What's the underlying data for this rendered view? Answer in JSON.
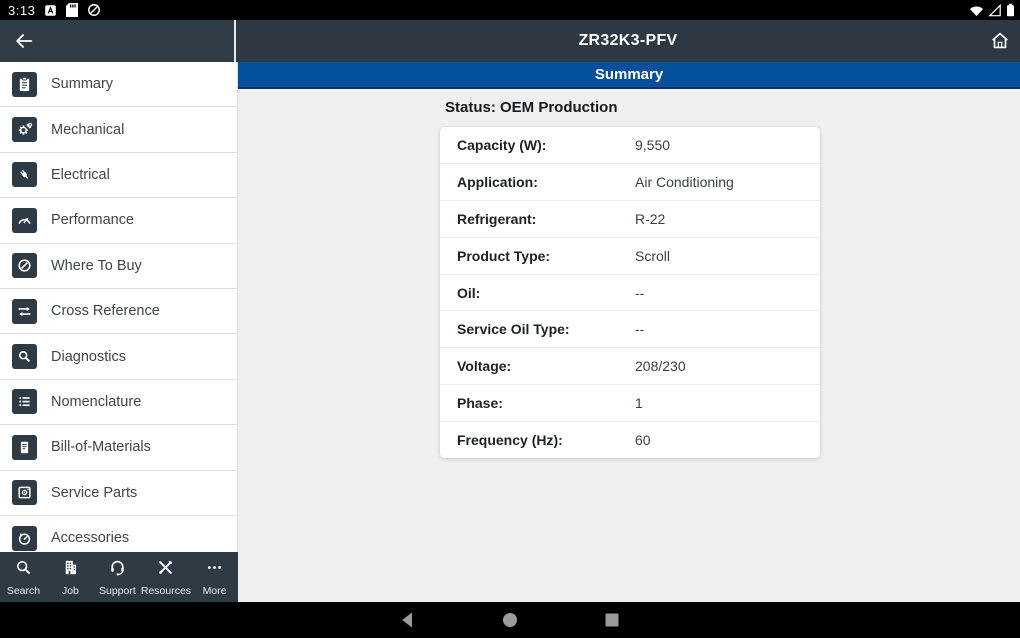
{
  "status_bar": {
    "time": "3:13",
    "left_icons": [
      "auto-rotate-a-icon",
      "sd-card-icon",
      "data-saver-icon"
    ],
    "right_icons": [
      "wifi-icon",
      "cell-signal-icon",
      "battery-icon"
    ]
  },
  "app_header": {
    "title": "ZR32K3-PFV",
    "back_icon": "back-arrow-icon",
    "home_icon": "home-icon"
  },
  "banner": {
    "label": "Summary"
  },
  "main": {
    "status_line": "Status: OEM Production",
    "spec_table": {
      "rows": [
        {
          "label": "Capacity (W):",
          "value": "9,550"
        },
        {
          "label": "Application:",
          "value": "Air Conditioning"
        },
        {
          "label": "Refrigerant:",
          "value": "R-22"
        },
        {
          "label": "Product Type:",
          "value": "Scroll"
        },
        {
          "label": "Oil:",
          "value": "--"
        },
        {
          "label": "Service Oil Type:",
          "value": "--"
        },
        {
          "label": "Voltage:",
          "value": "208/230"
        },
        {
          "label": "Phase:",
          "value": "1"
        },
        {
          "label": "Frequency (Hz):",
          "value": "60"
        }
      ]
    }
  },
  "sidebar": {
    "items": [
      {
        "label": "Summary",
        "icon": "clipboard-icon"
      },
      {
        "label": "Mechanical",
        "icon": "gear-wrench-icon"
      },
      {
        "label": "Electrical",
        "icon": "plug-icon"
      },
      {
        "label": "Performance",
        "icon": "gauge-arrow-icon"
      },
      {
        "label": "Where To Buy",
        "icon": "compass-icon"
      },
      {
        "label": "Cross Reference",
        "icon": "swap-arrows-icon"
      },
      {
        "label": "Diagnostics",
        "icon": "magnifier-icon"
      },
      {
        "label": "Nomenclature",
        "icon": "list-icon"
      },
      {
        "label": "Bill-of-Materials",
        "icon": "document-icon"
      },
      {
        "label": "Service Parts",
        "icon": "parts-box-icon"
      },
      {
        "label": "Accessories",
        "icon": "meter-icon"
      }
    ]
  },
  "tab_bar": {
    "items": [
      {
        "label": "Search",
        "icon": "search-icon"
      },
      {
        "label": "Job",
        "icon": "building-icon"
      },
      {
        "label": "Support",
        "icon": "headset-icon"
      },
      {
        "label": "Resources",
        "icon": "tools-icon"
      },
      {
        "label": "More",
        "icon": "more-dots-icon"
      }
    ]
  },
  "android_nav": {
    "icons": [
      "nav-back-icon",
      "nav-home-icon",
      "nav-recents-icon"
    ]
  },
  "colors": {
    "header_bg": "#2e3a44",
    "banner_bg": "#04509c",
    "banner_border": "#152f66",
    "content_bg": "#efefef",
    "tile_bg": "#2e3a44",
    "status_bar_bg": "#000000"
  }
}
